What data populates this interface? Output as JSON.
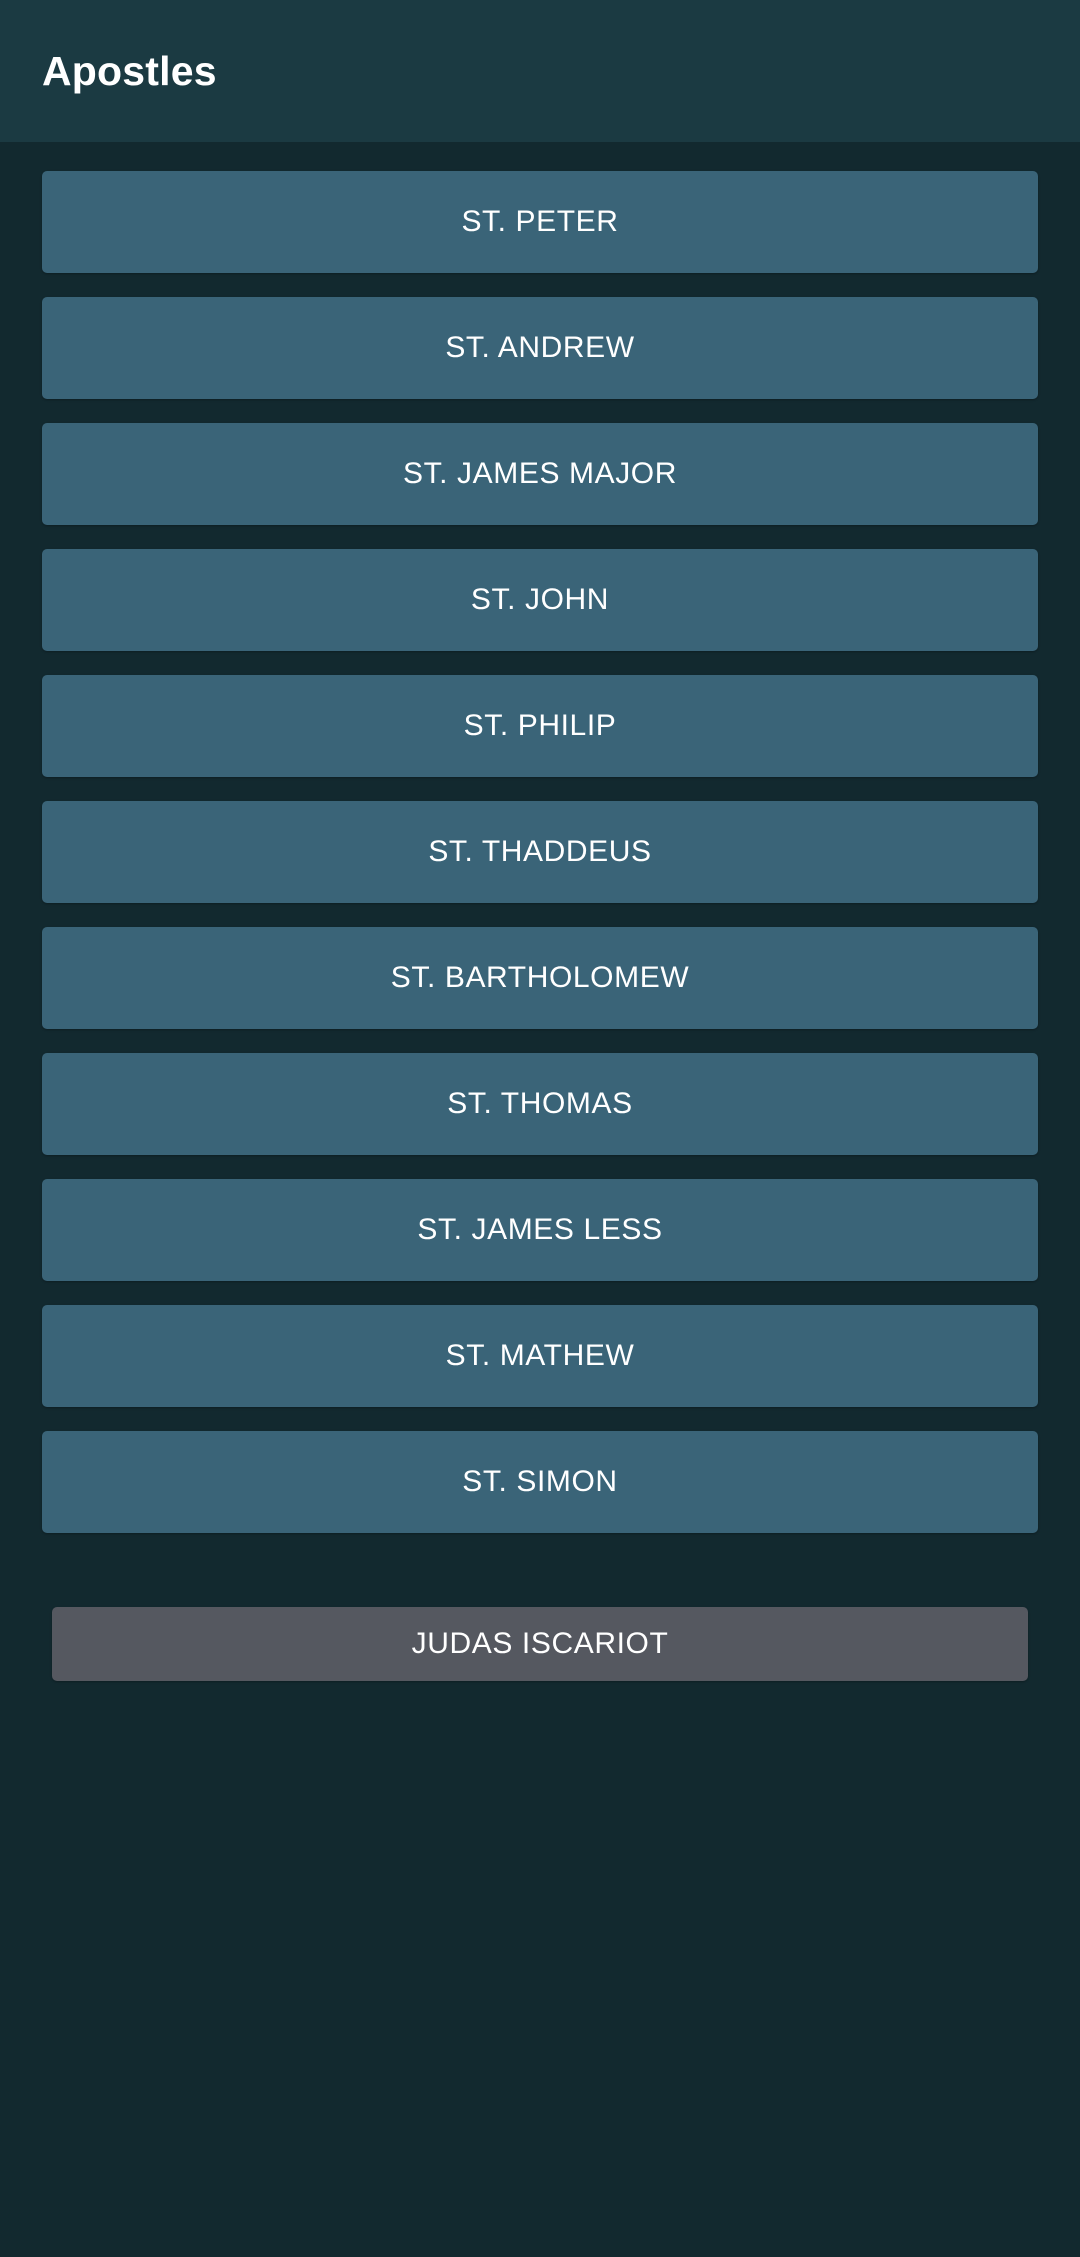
{
  "appbar": {
    "title": "Apostles"
  },
  "theme": {
    "background": "#12292f",
    "appbar_background": "#1b3a42",
    "saint_button_color": "#3a6478",
    "traitor_button_color": "#555860",
    "text_color": "#ffffff"
  },
  "main": {
    "apostles": [
      {
        "label": "ST. PETER"
      },
      {
        "label": "ST. ANDREW"
      },
      {
        "label": "ST. JAMES MAJOR"
      },
      {
        "label": "ST. JOHN"
      },
      {
        "label": "ST. PHILIP"
      },
      {
        "label": "ST. THADDEUS"
      },
      {
        "label": "ST. BARTHOLOMEW"
      },
      {
        "label": "ST. THOMAS"
      },
      {
        "label": "ST. JAMES LESS"
      },
      {
        "label": "ST. MATHEW"
      },
      {
        "label": "ST. SIMON"
      }
    ],
    "traitor": {
      "label": "JUDAS ISCARIOT"
    }
  }
}
